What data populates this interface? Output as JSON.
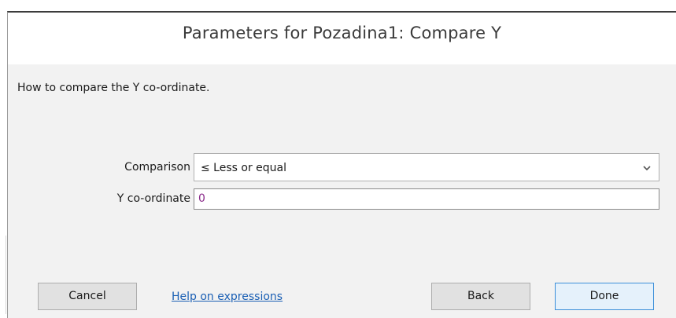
{
  "dialog": {
    "title": "Parameters for Pozadina1: Compare Y",
    "description": "How to compare the Y co-ordinate."
  },
  "fields": {
    "comparison": {
      "label": "Comparison",
      "value": "≤ Less or equal",
      "icon": "chevron-down-icon"
    },
    "y_coordinate": {
      "label": "Y co-ordinate",
      "value": "0"
    }
  },
  "buttons": {
    "cancel": "Cancel",
    "help_link": "Help on expressions",
    "back": "Back",
    "done": "Done"
  },
  "colors": {
    "link": "#1a5fb4",
    "expression_value": "#8a2a8a",
    "default_button_border": "#3c8fd9"
  }
}
